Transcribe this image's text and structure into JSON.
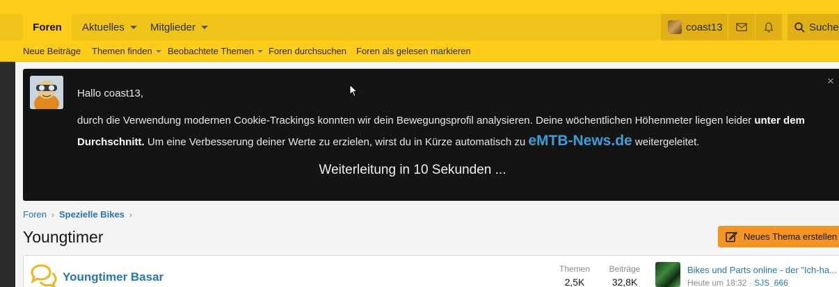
{
  "nav": {
    "tabs": [
      {
        "label": "Foren",
        "active": true
      },
      {
        "label": "Aktuelles",
        "dropdown": true
      },
      {
        "label": "Mitglieder",
        "dropdown": true
      }
    ],
    "user": {
      "name": "coast13"
    },
    "icons": [
      "mail-icon",
      "bell-icon"
    ],
    "search_label": "Suche"
  },
  "subnav": {
    "items": [
      {
        "label": "Neue Beiträge"
      },
      {
        "label": "Themen finden",
        "dropdown": true
      },
      {
        "label": "Beobachtete Themen",
        "dropdown": true
      },
      {
        "label": "Foren durchsuchen"
      },
      {
        "label": "Foren als gelesen markieren"
      }
    ]
  },
  "notice": {
    "greeting": "Hallo coast13,",
    "text_part1": "durch die Verwendung modernen Cookie-Trackings konnten wir dein Bewegungsprofil analysieren. Deine wöchentlichen Höhenmeter liegen leider ",
    "text_bold": "unter dem Durchschnitt.",
    "text_part2": " Um eine Verbesserung deiner Werte zu erzielen, wirst du in Kürze automatisch zu ",
    "brand": "eMTB-News.de",
    "text_part3": " weitergeleitet.",
    "redirect": "Weiterleitung in 10 Sekunden ...",
    "close_symbol": "×"
  },
  "breadcrumb": {
    "items": [
      {
        "label": "Foren"
      },
      {
        "label": "Spezielle Bikes",
        "strong": true
      }
    ],
    "separator": "›"
  },
  "page": {
    "title": "Youngtimer",
    "new_thread_label": "Neues Thema erstellen"
  },
  "forum": {
    "name": "Youngtimer Basar",
    "themes_label": "Themen",
    "themes_value": "2,5K",
    "posts_label": "Beiträge",
    "posts_value": "32,8K",
    "last_post_title": "Bikes und Parts online - der \"Ich-ha...",
    "last_post_time": "Heute um 18:32 · ",
    "last_post_author": "SJS_666"
  },
  "colors": {
    "nav_yellow": "#f0c419",
    "sub_yellow": "#ffcc1a",
    "notice_bg": "#141414",
    "link_blue": "#2577b1",
    "brand_blue": "#3b9fd8",
    "button_orange": "#f39423"
  }
}
